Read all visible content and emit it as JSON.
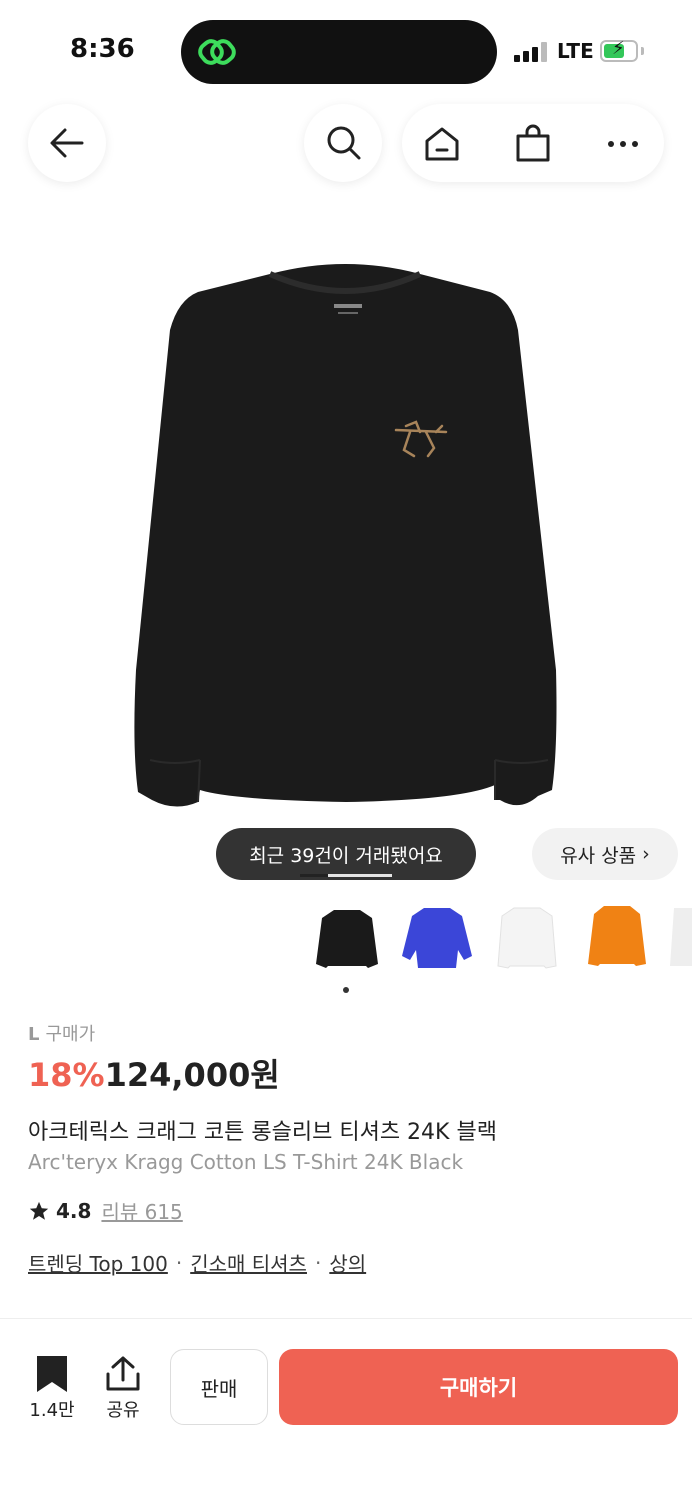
{
  "status": {
    "time": "8:36",
    "network": "LTE"
  },
  "nav": {
    "back_icon": "arrow-left-icon",
    "search_icon": "search-icon",
    "home_icon": "home-icon",
    "bag_icon": "shopping-bag-icon",
    "more_icon": "more-horizontal-icon"
  },
  "gallery": {
    "toast": "최근 39건이 거래됐어요",
    "similar_label": "유사 상품",
    "similar_chevron": "›",
    "image_count": 5,
    "active_index": 1
  },
  "thumbnails": [
    {
      "name": "black",
      "color": "#1a1a1a"
    },
    {
      "name": "blue",
      "color": "#3b46d8"
    },
    {
      "name": "white",
      "color": "#f4f4f4"
    },
    {
      "name": "orange",
      "color": "#f08214"
    },
    {
      "name": "white-2",
      "color": "#eeeeee"
    }
  ],
  "product": {
    "size": "L",
    "price_label": "구매가",
    "discount": "18%",
    "price": "124,000원",
    "name_ko": "아크테릭스 크래그 코튼 롱슬리브 티셔츠 24K 블랙",
    "name_en": "Arc'teryx Kragg Cotton LS T-Shirt 24K Black",
    "rating": "4.8",
    "review_label": "리뷰 615",
    "tags": [
      "트렌딩 Top 100",
      "긴소매 티셔츠",
      "상의"
    ],
    "tag_separator": "·"
  },
  "colors": {
    "accent": "#ef6253",
    "shirt": "#1b1b1b",
    "logo": "#a8845a"
  },
  "bottom": {
    "wish_count": "1.4만",
    "share_label": "공유",
    "sell_label": "판매",
    "buy_label": "구매하기"
  }
}
